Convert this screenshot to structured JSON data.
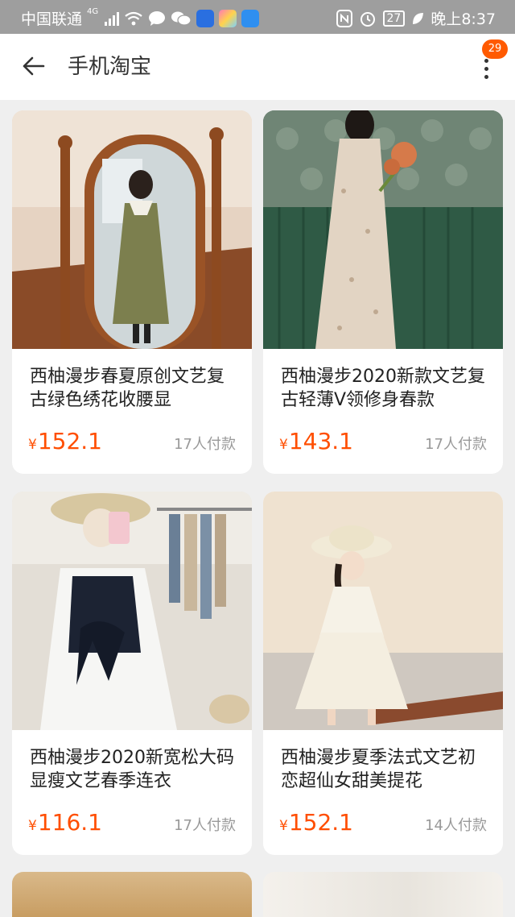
{
  "status_bar": {
    "carrier": "中国联通",
    "network": "4G",
    "battery": "27",
    "time": "晚上8:37"
  },
  "app_bar": {
    "title": "手机淘宝",
    "badge_count": "29"
  },
  "products": [
    {
      "title": "西柚漫步春夏原创文艺复古绿色绣花收腰显",
      "currency": "¥",
      "price": "152.1",
      "paid": "17人付款"
    },
    {
      "title": "西柚漫步2020新款文艺复古轻薄V领修身春款",
      "currency": "¥",
      "price": "143.1",
      "paid": "17人付款"
    },
    {
      "title": "西柚漫步2020新宽松大码显瘦文艺春季连衣",
      "currency": "¥",
      "price": "116.1",
      "paid": "17人付款"
    },
    {
      "title": "西柚漫步夏季法式文艺初恋超仙女甜美提花",
      "currency": "¥",
      "price": "152.1",
      "paid": "14人付款"
    }
  ],
  "colors": {
    "accent": "#ff4e00",
    "badge": "#ff5a00",
    "status_bar": "#9e9e9e",
    "background": "#efefef"
  },
  "icons": [
    "back-arrow-icon",
    "more-vertical-icon",
    "wifi-icon",
    "nfc-icon",
    "alarm-icon",
    "leaf-icon"
  ]
}
